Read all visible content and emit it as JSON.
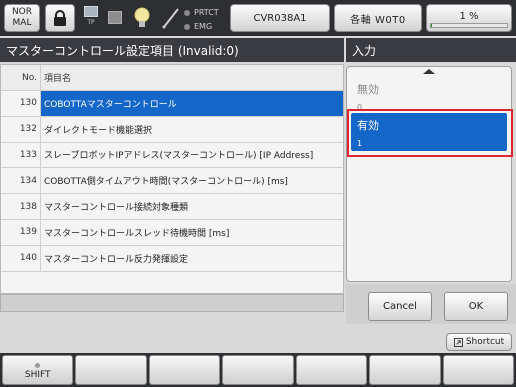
{
  "status_bar": {
    "mode_label": "NOR\nMAL",
    "tp_label": "TP",
    "prtct_label": "PRTCT",
    "emg_label": "EMG",
    "robot_name": "CVR038A1",
    "axis_label": "各軸 W0T0",
    "speed_label": "1 %",
    "speed_fraction": 0.01,
    "icons": [
      "lock-icon",
      "teach-pendant-icon",
      "stop-icon",
      "lightbulb-icon",
      "pen-icon"
    ]
  },
  "main": {
    "title": "マスターコントロール設定項目 (Invalid:0)",
    "columns": {
      "no": "No.",
      "name": "項目名"
    },
    "rows": [
      {
        "no": "130",
        "name": "COBOTTAマスターコントロール",
        "selected": true
      },
      {
        "no": "132",
        "name": "ダイレクトモード機能選択"
      },
      {
        "no": "133",
        "name": "スレーブロボットIPアドレス(マスターコントロール) [IP Address]"
      },
      {
        "no": "134",
        "name": "COBOTTA側タイムアウト時間(マスターコントロール) [ms]"
      },
      {
        "no": "138",
        "name": "マスターコントロール接続対象種類"
      },
      {
        "no": "139",
        "name": "マスターコントロールスレッド待機時間 [ms]"
      },
      {
        "no": "140",
        "name": "マスターコントロール反力発揮設定"
      }
    ]
  },
  "input_panel": {
    "title": "入力",
    "options": [
      {
        "label": "無効",
        "value": "0"
      },
      {
        "label": "有効",
        "value": "1",
        "selected": true
      }
    ],
    "cancel_label": "Cancel",
    "ok_label": "OK"
  },
  "shortcut_label": "Shortcut",
  "function_keys": [
    "SHIFT",
    "",
    "",
    "",
    "",
    "",
    "",
    ""
  ],
  "colors": {
    "selection": "#1467c9",
    "highlight_frame": "#e0242f",
    "header_bg": "#3a3b40"
  }
}
